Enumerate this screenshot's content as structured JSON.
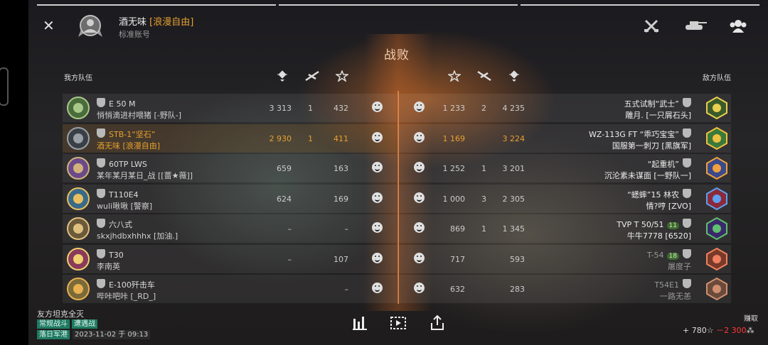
{
  "header": {
    "player_name": "酒无味",
    "player_clan": "[浪漫自由]",
    "account_type": "标准账号",
    "result": "战败"
  },
  "teams": {
    "ally_label": "我方队伍",
    "enemy_label": "敌方队伍"
  },
  "rows": [
    {
      "l_tank": "E 50 M",
      "l_player": "悄悄滴进村喂猪 [-野队-]",
      "l_dmg": "3 313",
      "l_kills": "1",
      "l_xp": "432",
      "r_xp": "1 233",
      "r_kills": "2",
      "r_dmg": "4 235",
      "r_tank": "五式试制“武士”",
      "r_player": "雕月. [一只屑石头]",
      "r_lvl": ""
    },
    {
      "l_tank": "STB-1“坚石”",
      "l_player": "酒无味 [浪漫自由]",
      "l_dmg": "2 930",
      "l_kills": "1",
      "l_xp": "411",
      "r_xp": "1 169",
      "r_kills": "",
      "r_dmg": "3 224",
      "r_tank": "WZ-113G FT “乖巧宝宝”",
      "r_player": "国服第一刺刀 [黑旗军]",
      "r_lvl": ""
    },
    {
      "l_tank": "60TP LWS",
      "l_player": "某年某月某日_战 [[蔷★薇]]",
      "l_dmg": "659",
      "l_kills": "",
      "l_xp": "163",
      "r_xp": "1 252",
      "r_kills": "1",
      "r_dmg": "3 201",
      "r_tank": "“起重机”",
      "r_player": "沉沦素未谋面 [一野队一]",
      "r_lvl": ""
    },
    {
      "l_tank": "T110E4",
      "l_player": "wuli啾啾 [警察]",
      "l_dmg": "624",
      "l_kills": "",
      "l_xp": "169",
      "r_xp": "1 000",
      "r_kills": "3",
      "r_dmg": "2 305",
      "r_tank": "“蟋蟀”15 林农",
      "r_player": "情?哼 [ZVO]",
      "r_lvl": ""
    },
    {
      "l_tank": "六八式",
      "l_player": "skxjhdbxhhhx [加油.]",
      "l_dmg": "–",
      "l_kills": "",
      "l_xp": "–",
      "r_xp": "869",
      "r_kills": "1",
      "r_dmg": "1 345",
      "r_tank": "TVP T 50/51",
      "r_player": "牛牛7778 [6520]",
      "r_lvl": "11"
    },
    {
      "l_tank": "T30",
      "l_player": "李南英",
      "l_dmg": "–",
      "l_kills": "",
      "l_xp": "107",
      "r_xp": "717",
      "r_kills": "",
      "r_dmg": "593",
      "r_tank": "T-54",
      "r_player": "屠度子",
      "r_lvl": "18"
    },
    {
      "l_tank": "E-100歼击车",
      "l_player": "哔咔吧咔 [_RD_]",
      "l_dmg": "",
      "l_kills": "",
      "l_xp": "–",
      "r_xp": "632",
      "r_kills": "",
      "r_dmg": "283",
      "r_tank": "T54E1",
      "r_player": "一路无恙",
      "r_lvl": ""
    }
  ],
  "footer": {
    "title": "友方坦克全灭",
    "tag1": "常规战斗",
    "tag2": "遭遇战",
    "map": "落日军港",
    "date": "2023-11-02 于 09:13",
    "earn_label": "赚取",
    "earn_xp": "+ 780",
    "earn_credits": "－2 300"
  },
  "icons": {
    "close": "close-icon",
    "weapons": "crossed-guns-icon",
    "tank": "tank-icon",
    "group": "group-icon",
    "stats": "bar-chart-icon",
    "replay": "replay-icon",
    "share": "share-icon"
  },
  "colors": {
    "accent": "#e8a030",
    "negative": "#ff3a3a",
    "tag_green": "#1f7a62"
  }
}
